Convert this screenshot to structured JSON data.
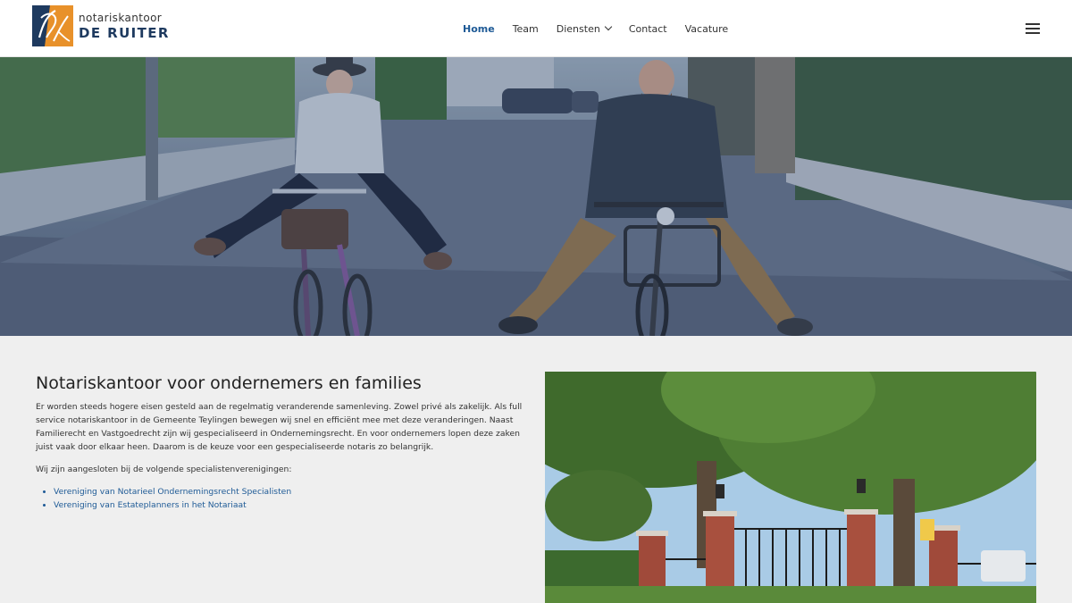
{
  "brand": {
    "name_top": "notariskantoor",
    "name_bottom": "DE RUITER",
    "colors": {
      "blue": "#1e3a5f",
      "orange": "#e8912a",
      "link": "#1e5a96"
    }
  },
  "nav": {
    "items": [
      {
        "label": "Home",
        "active": true
      },
      {
        "label": "Team"
      },
      {
        "label": "Diensten",
        "has_dropdown": true
      },
      {
        "label": "Contact"
      },
      {
        "label": "Vacature"
      }
    ],
    "menu_icon": "hamburger-icon"
  },
  "hero": {
    "image": "two-people-riding-bicycles"
  },
  "main": {
    "title": "Notariskantoor voor ondernemers en families",
    "paragraph": "Er worden steeds hogere eisen gesteld aan de regelmatig veranderende samenleving. Zowel privé als zakelijk. Als full service notariskantoor in de Gemeente Teylingen bewegen wij snel en efficiënt mee met deze veranderingen. Naast Familierecht en Vastgoedrecht zijn wij gespecialiseerd in Ondernemingsrecht. En voor ondernemers lopen deze zaken juist vaak door elkaar heen. Daarom is de keuze voor een gespecialiseerde notaris zo belangrijk.",
    "intro_links": "Wij zijn aangesloten bij de volgende specialistenverenigingen:",
    "links": [
      "Vereniging van Notarieel Ondernemingsrecht Specialisten",
      "Vereniging van Estateplanners in het Notariaat"
    ],
    "photo": "brick-gate-with-trees"
  }
}
